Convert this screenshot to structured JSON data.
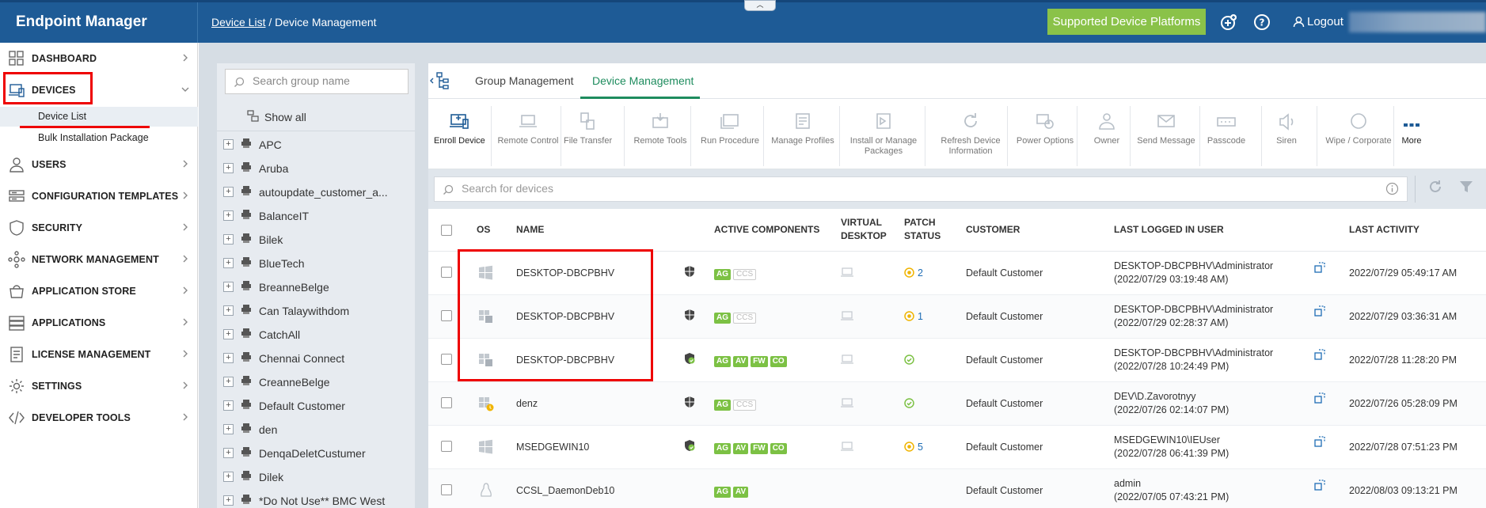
{
  "app": {
    "title": "Endpoint Manager",
    "breadcrumb": {
      "link": "Device List",
      "separator": "/",
      "current": "Device Management"
    },
    "collapse_glyph": "︿",
    "supported_platforms_label": "Supported Device Platforms",
    "logout_label": "Logout"
  },
  "sidebar": {
    "items": [
      {
        "label": "DASHBOARD",
        "icon": "dashboard-icon"
      },
      {
        "label": "DEVICES",
        "icon": "devices-icon"
      },
      {
        "label": "USERS",
        "icon": "users-icon"
      },
      {
        "label": "CONFIGURATION TEMPLATES",
        "icon": "templates-icon"
      },
      {
        "label": "SECURITY",
        "icon": "shield-icon"
      },
      {
        "label": "NETWORK MANAGEMENT",
        "icon": "network-icon"
      },
      {
        "label": "APPLICATION STORE",
        "icon": "store-icon"
      },
      {
        "label": "APPLICATIONS",
        "icon": "applications-icon"
      },
      {
        "label": "LICENSE MANAGEMENT",
        "icon": "license-icon"
      },
      {
        "label": "SETTINGS",
        "icon": "gear-icon"
      },
      {
        "label": "DEVELOPER TOOLS",
        "icon": "code-icon"
      }
    ],
    "sub_items": [
      {
        "label": "Device List",
        "active": true
      },
      {
        "label": "Bulk Installation Package",
        "active": false
      }
    ]
  },
  "groups": {
    "search_placeholder": "Search group name",
    "show_all_label": "Show all",
    "items": [
      "APC",
      "Aruba",
      "autoupdate_customer_a...",
      "BalanceIT",
      "Bilek",
      "BlueTech",
      "BreanneBelge",
      "Can Talaywithdom",
      "CatchAll",
      "Chennai Connect",
      "CreanneBelge",
      "Default Customer",
      "den",
      "DenqaDeletCustumer",
      "Dilek",
      "*Do Not Use** BMC West"
    ]
  },
  "tabs": [
    {
      "label": "Group Management",
      "active": false
    },
    {
      "label": "Device Management",
      "active": true
    }
  ],
  "toolbar": [
    {
      "label": "Enroll Device",
      "icon": "enroll-device-icon",
      "enabled": true
    },
    {
      "label": "Remote Control",
      "icon": "laptop-icon",
      "enabled": false
    },
    {
      "label": "File Transfer",
      "icon": "file-transfer-icon",
      "enabled": false
    },
    {
      "label": "Remote Tools",
      "icon": "remote-tools-icon",
      "enabled": false
    },
    {
      "label": "Run Procedure",
      "icon": "run-procedure-icon",
      "enabled": false
    },
    {
      "label": "Manage Profiles",
      "icon": "manage-profiles-icon",
      "enabled": false
    },
    {
      "label": "Install or Manage\nPackages",
      "icon": "packages-icon",
      "enabled": false
    },
    {
      "label": "Refresh Device\nInformation",
      "icon": "refresh-icon",
      "enabled": false
    },
    {
      "label": "Power Options",
      "icon": "power-icon",
      "enabled": false
    },
    {
      "label": "Owner",
      "icon": "owner-icon",
      "enabled": false
    },
    {
      "label": "Send Message",
      "icon": "mail-icon",
      "enabled": false
    },
    {
      "label": "Passcode",
      "icon": "passcode-icon",
      "enabled": false
    },
    {
      "label": "Siren",
      "icon": "siren-icon",
      "enabled": false
    },
    {
      "label": "Wipe / Corporate",
      "icon": "wipe-icon",
      "enabled": false
    },
    {
      "label": "More",
      "icon": "more-icon",
      "enabled": true
    }
  ],
  "device_search_placeholder": "Search for devices",
  "table": {
    "headers": {
      "os": "OS",
      "name": "NAME",
      "active_components": "ACTIVE COMPONENTS",
      "virtual_desktop": [
        "VIRTUAL",
        "DESKTOP"
      ],
      "patch_status": [
        "PATCH",
        "STATUS"
      ],
      "customer": "CUSTOMER",
      "last_logged_in_user": "LAST LOGGED IN USER",
      "last_activity": "LAST ACTIVITY"
    },
    "rows": [
      {
        "os": "windows-icon",
        "name": "DESKTOP-DBCPBHV",
        "shield": "shield-dark-icon",
        "components": [
          {
            "t": "AG",
            "on": true
          },
          {
            "t": "CCS",
            "on": false
          }
        ],
        "patch": {
          "state": "warning",
          "count": "2"
        },
        "customer": "Default Customer",
        "user": "DESKTOP-DBCPBHV\\Administrator",
        "user_time": "(2022/07/29 03:19:48 AM)",
        "last_activity": "2022/07/29 05:49:17 AM"
      },
      {
        "os": "windows-server-icon",
        "name": "DESKTOP-DBCPBHV",
        "shield": "shield-dark-icon",
        "components": [
          {
            "t": "AG",
            "on": true
          },
          {
            "t": "CCS",
            "on": false
          }
        ],
        "patch": {
          "state": "warning",
          "count": "1"
        },
        "customer": "Default Customer",
        "user": "DESKTOP-DBCPBHV\\Administrator",
        "user_time": "(2022/07/29 02:28:37 AM)",
        "last_activity": "2022/07/29 03:36:31 AM"
      },
      {
        "os": "windows-server-icon",
        "name": "DESKTOP-DBCPBHV",
        "shield": "shield-green-icon",
        "components": [
          {
            "t": "AG",
            "on": true
          },
          {
            "t": "AV",
            "on": true
          },
          {
            "t": "FW",
            "on": true
          },
          {
            "t": "CO",
            "on": true
          }
        ],
        "patch": {
          "state": "ok",
          "count": ""
        },
        "customer": "Default Customer",
        "user": "DESKTOP-DBCPBHV\\Administrator",
        "user_time": "(2022/07/28 10:24:49 PM)",
        "last_activity": "2022/07/28 11:28:20 PM"
      },
      {
        "os": "windows-server-warn-icon",
        "name": "denz",
        "shield": "shield-dark-icon",
        "components": [
          {
            "t": "AG",
            "on": true
          },
          {
            "t": "CCS",
            "on": false
          }
        ],
        "patch": {
          "state": "ok",
          "count": ""
        },
        "customer": "Default Customer",
        "user": "DEV\\D.Zavorotnyy",
        "user_time": "(2022/07/26 02:14:07 PM)",
        "last_activity": "2022/07/26 05:28:09 PM"
      },
      {
        "os": "windows-icon",
        "name": "MSEDGEWIN10",
        "shield": "shield-green-icon",
        "components": [
          {
            "t": "AG",
            "on": true
          },
          {
            "t": "AV",
            "on": true
          },
          {
            "t": "FW",
            "on": true
          },
          {
            "t": "CO",
            "on": true
          }
        ],
        "patch": {
          "state": "warning",
          "count": "5"
        },
        "customer": "Default Customer",
        "user": "MSEDGEWIN10\\IEUser",
        "user_time": "(2022/07/28 06:41:39 PM)",
        "last_activity": "2022/07/28 07:51:23 PM"
      },
      {
        "os": "linux-icon",
        "name": "CCSL_DaemonDeb10",
        "shield": "",
        "components": [
          {
            "t": "AG",
            "on": true
          },
          {
            "t": "AV",
            "on": true
          }
        ],
        "patch": {
          "state": "none",
          "count": ""
        },
        "customer": "Default Customer",
        "user": "admin",
        "user_time": "(2022/07/05 07:43:21 PM)",
        "last_activity": "2022/08/03 09:13:21 PM"
      }
    ]
  },
  "colors": {
    "topbar": "#1e5b96",
    "accent_green": "#1e8c5e",
    "badge_green": "#7cc144",
    "platforms_button": "#8ac249",
    "highlight_red": "#e00000",
    "patch_warning": "#f0b400"
  }
}
